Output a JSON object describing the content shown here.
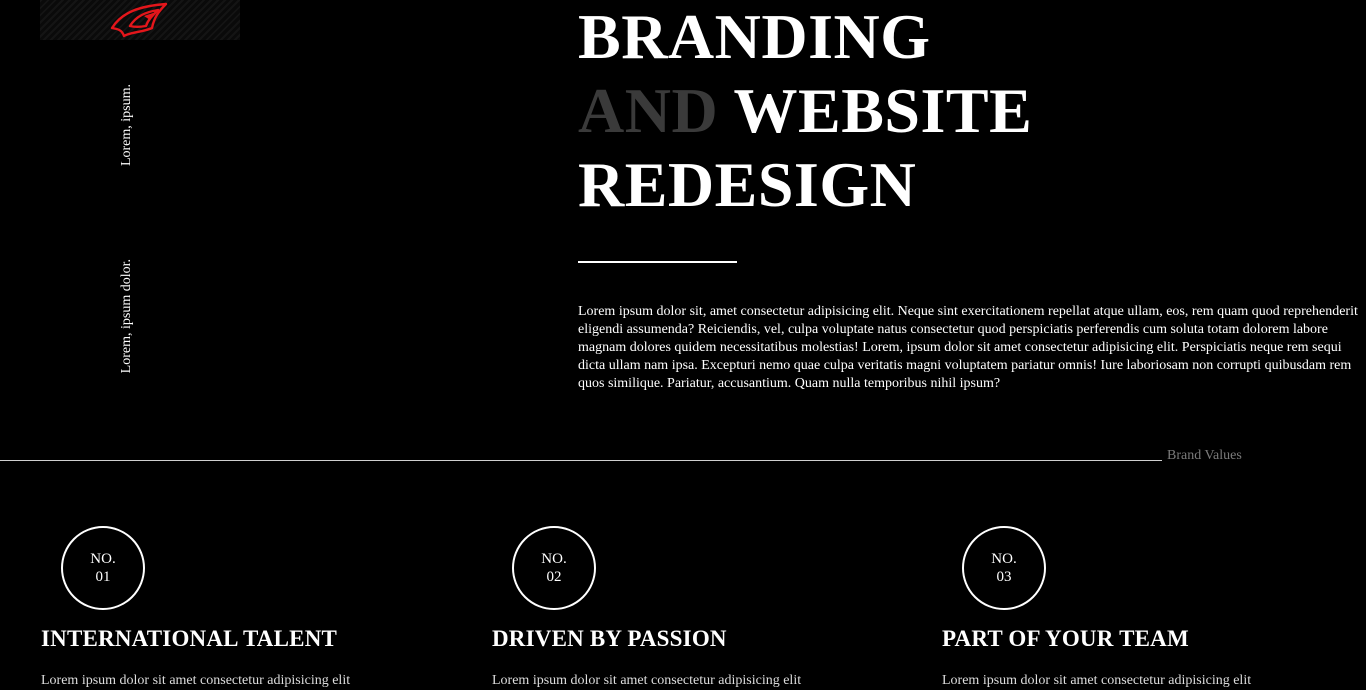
{
  "brand": {
    "logo_icon": "rog-eye-logo",
    "logo_color": "#e4161b"
  },
  "side_labels": [
    "Lorem, ipsum.",
    "Lorem, ipsum dolor."
  ],
  "hero": {
    "title_line1": "BRANDING",
    "title_line2_dim": "AND",
    "title_line2": " WEBSITE",
    "title_line3": "REDESIGN",
    "body": "Lorem ipsum dolor sit, amet consectetur adipisicing elit. Neque sint exercitationem repellat atque ullam, eos, rem quam quod reprehenderit eligendi assumenda? Reiciendis, vel, culpa voluptate natus consectetur quod perspiciatis perferendis cum soluta totam dolorem labore magnam dolores quidem necessitatibus molestias! Lorem, ipsum dolor sit amet consectetur adipisicing elit. Perspiciatis neque rem sequi dicta ullam nam ipsa. Excepturi nemo quae culpa veritatis magni voluptatem pariatur omnis! Iure laboriosam non corrupti quibusdam rem quos similique. Pariatur, accusantium. Quam nulla temporibus nihil ipsum?"
  },
  "section": {
    "label": "Brand Values"
  },
  "values": [
    {
      "no_label": "NO.",
      "number": "01",
      "title": "INTERNATIONAL TALENT",
      "text": "Lorem ipsum dolor sit amet consectetur adipisicing elit"
    },
    {
      "no_label": "NO.",
      "number": "02",
      "title": "DRIVEN BY PASSION",
      "text": "Lorem ipsum dolor sit amet consectetur adipisicing elit"
    },
    {
      "no_label": "NO.",
      "number": "03",
      "title": "PART OF YOUR TEAM",
      "text": "Lorem ipsum dolor sit amet consectetur adipisicing elit"
    }
  ],
  "colors": {
    "background": "#000000",
    "text": "#ffffff",
    "dim_text": "#3a3a3a",
    "muted_label": "#7a7a7a",
    "accent": "#e4161b"
  }
}
